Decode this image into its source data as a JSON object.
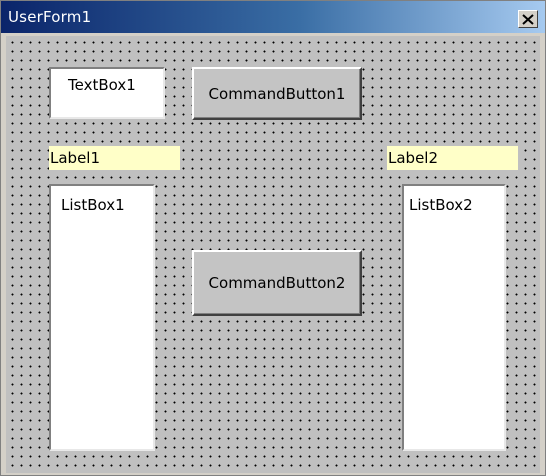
{
  "window": {
    "title": "UserForm1",
    "close_icon": "close-icon"
  },
  "controls": {
    "textbox1": "TextBox1",
    "command_button1": "CommandButton1",
    "label1": "Label1",
    "label2": "Label2",
    "listbox1": "ListBox1",
    "command_button2": "CommandButton2",
    "listbox2": "ListBox2"
  },
  "colors": {
    "title_bar_start": "#0a246a",
    "title_bar_end": "#a6caf0",
    "form_background": "#c0c0c0",
    "label_background": "#ffffc8"
  }
}
